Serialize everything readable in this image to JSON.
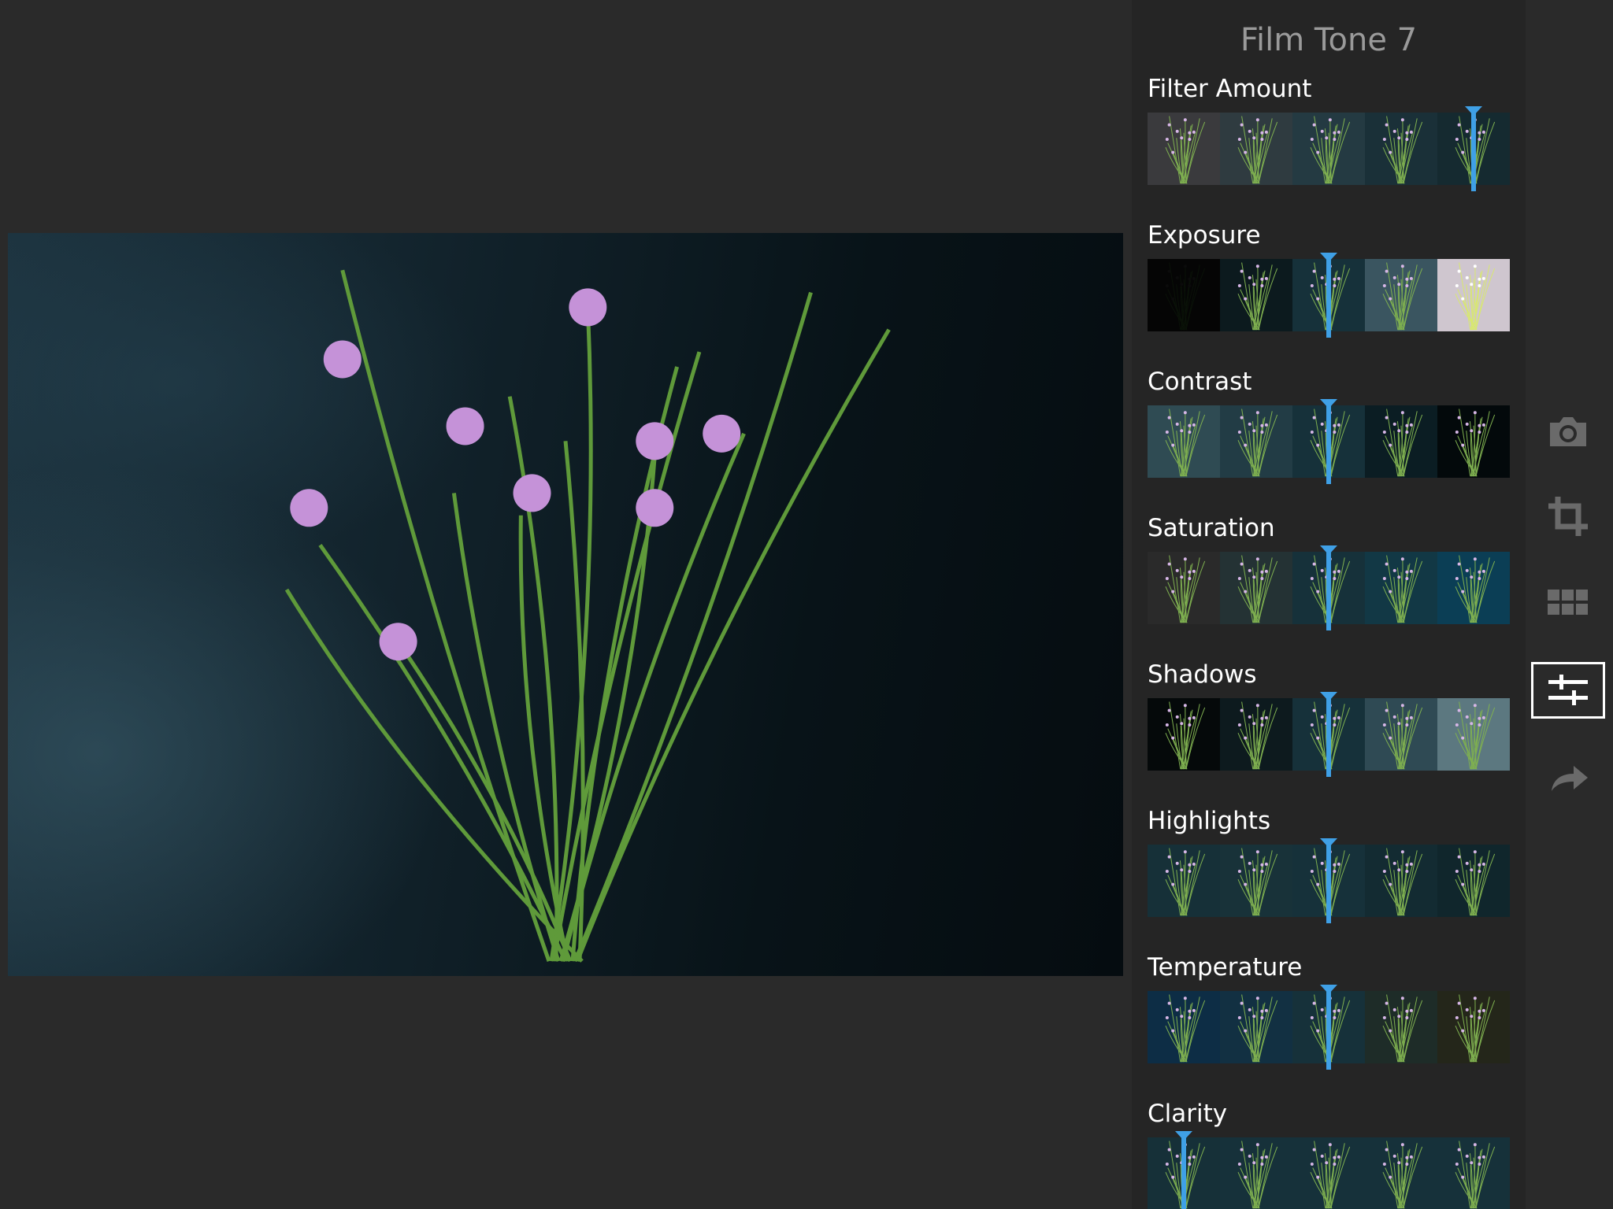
{
  "panel": {
    "title": "Film Tone 7",
    "adjustments": [
      {
        "label": "Filter Amount",
        "level": 1.0,
        "thumbs": [
          "#3a3a3d",
          "#2f3b40",
          "#243a42",
          "#1a3038",
          "#152a30"
        ],
        "brightness": [
          1.0,
          1.0,
          1.0,
          1.0,
          1.0
        ]
      },
      {
        "label": "Exposure",
        "level": 0.5,
        "thumbs": [
          "#050505",
          "#0c1a1e",
          "#16313a",
          "#3a5560",
          "#cfc6cf"
        ],
        "brightness": [
          0.1,
          0.4,
          1.0,
          1.2,
          1.5
        ]
      },
      {
        "label": "Contrast",
        "level": 0.5,
        "thumbs": [
          "#2f4b53",
          "#223c45",
          "#16313a",
          "#0b1d23",
          "#03090b"
        ],
        "brightness": [
          1.0,
          1.0,
          1.0,
          1.0,
          1.0
        ]
      },
      {
        "label": "Saturation",
        "level": 0.5,
        "thumbs": [
          "#2a2a2a",
          "#243234",
          "#16313a",
          "#123845",
          "#0b3e55"
        ],
        "brightness": [
          1.0,
          1.0,
          1.0,
          1.0,
          1.0
        ]
      },
      {
        "label": "Shadows",
        "level": 0.5,
        "thumbs": [
          "#05090a",
          "#0d1a1e",
          "#16313a",
          "#2f4a54",
          "#5c7880"
        ],
        "brightness": [
          1.0,
          1.0,
          1.0,
          1.0,
          1.0
        ]
      },
      {
        "label": "Highlights",
        "level": 0.5,
        "thumbs": [
          "#163038",
          "#183239",
          "#16313a",
          "#132b32",
          "#10262c"
        ],
        "brightness": [
          1.0,
          1.0,
          1.0,
          1.0,
          1.0
        ]
      },
      {
        "label": "Temperature",
        "level": 0.5,
        "thumbs": [
          "#0d2d45",
          "#123042",
          "#16313a",
          "#1e2c28",
          "#24261a"
        ],
        "brightness": [
          1.0,
          1.0,
          1.0,
          1.0,
          1.0
        ]
      },
      {
        "label": "Clarity",
        "level": 0.1,
        "thumbs": [
          "#163038",
          "#16313a",
          "#16313a",
          "#16313a",
          "#16313a"
        ],
        "brightness": [
          1.0,
          1.0,
          1.0,
          1.0,
          1.0
        ]
      }
    ]
  },
  "toolbar": {
    "tools": [
      {
        "name": "camera-icon",
        "active": false
      },
      {
        "name": "crop-icon",
        "active": false
      },
      {
        "name": "grid-icon",
        "active": false
      },
      {
        "name": "adjust-sliders-icon",
        "active": true
      },
      {
        "name": "share-arrow-icon",
        "active": false
      }
    ]
  },
  "colors": {
    "accent": "#3fa0e6",
    "background": "#2a2a2a",
    "panel": "#252525"
  }
}
